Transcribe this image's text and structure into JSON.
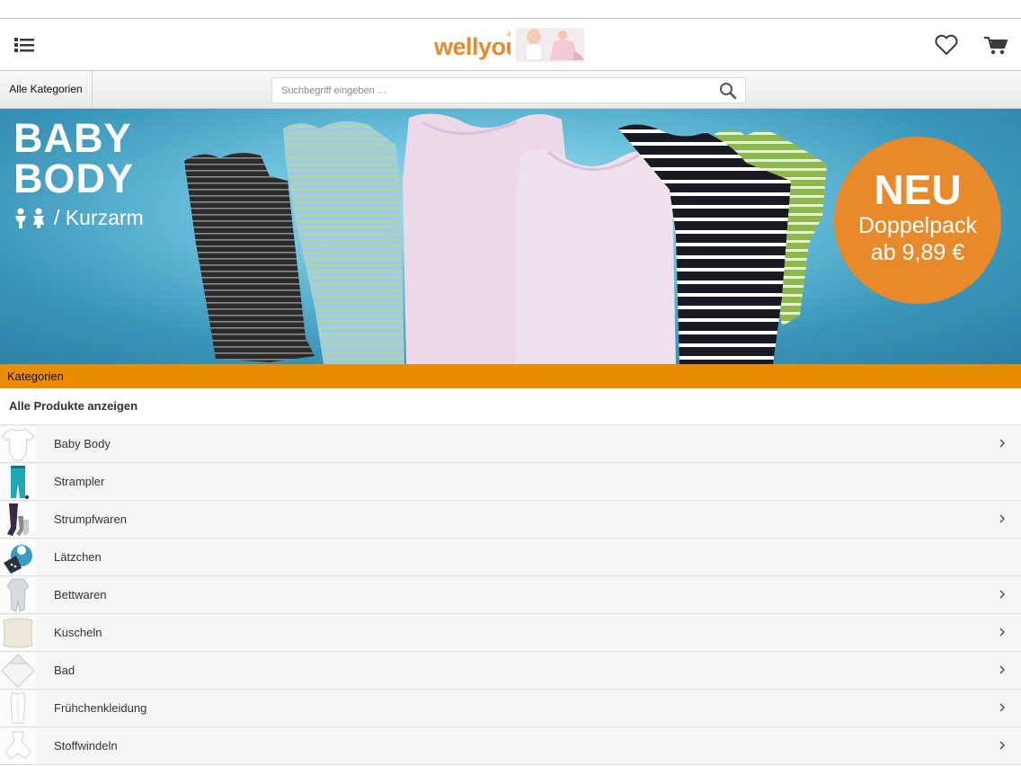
{
  "header": {
    "logo_text": "wellyou",
    "logo_reg": "®"
  },
  "search": {
    "category_button": "Alle Kategorien",
    "placeholder": "Suchbegriff eingeben …"
  },
  "banner": {
    "title_line1": "BABY",
    "title_line2": "BODY",
    "subtitle": "/ Kurzarm",
    "badge_line1": "NEU",
    "badge_line2": "Doppelpack",
    "badge_line3": "ab 9,89 €",
    "colors": {
      "badge": "#e8892a",
      "background": "#3a95b8"
    }
  },
  "categories": {
    "header": "Kategorien",
    "all_products": "Alle Produkte anzeigen",
    "items": [
      {
        "label": "Baby Body",
        "icon": "baby-body-thumbnail",
        "has_children": true
      },
      {
        "label": "Strampler",
        "icon": "romper-thumbnail",
        "has_children": false
      },
      {
        "label": "Strumpfwaren",
        "icon": "tights-thumbnail",
        "has_children": true
      },
      {
        "label": "Lätzchen",
        "icon": "bib-thumbnail",
        "has_children": false
      },
      {
        "label": "Bettwaren",
        "icon": "sleepsuit-thumbnail",
        "has_children": true
      },
      {
        "label": "Kuscheln",
        "icon": "pillow-thumbnail",
        "has_children": true
      },
      {
        "label": "Bad",
        "icon": "hooded-towel-thumbnail",
        "has_children": true
      },
      {
        "label": "Frühchenkleidung",
        "icon": "preemie-clothing-thumbnail",
        "has_children": true
      },
      {
        "label": "Stoffwindeln",
        "icon": "cloth-diaper-thumbnail",
        "has_children": true
      }
    ]
  },
  "theme": {
    "accent": "#e98c00",
    "logo_orange": "#e8892a"
  }
}
